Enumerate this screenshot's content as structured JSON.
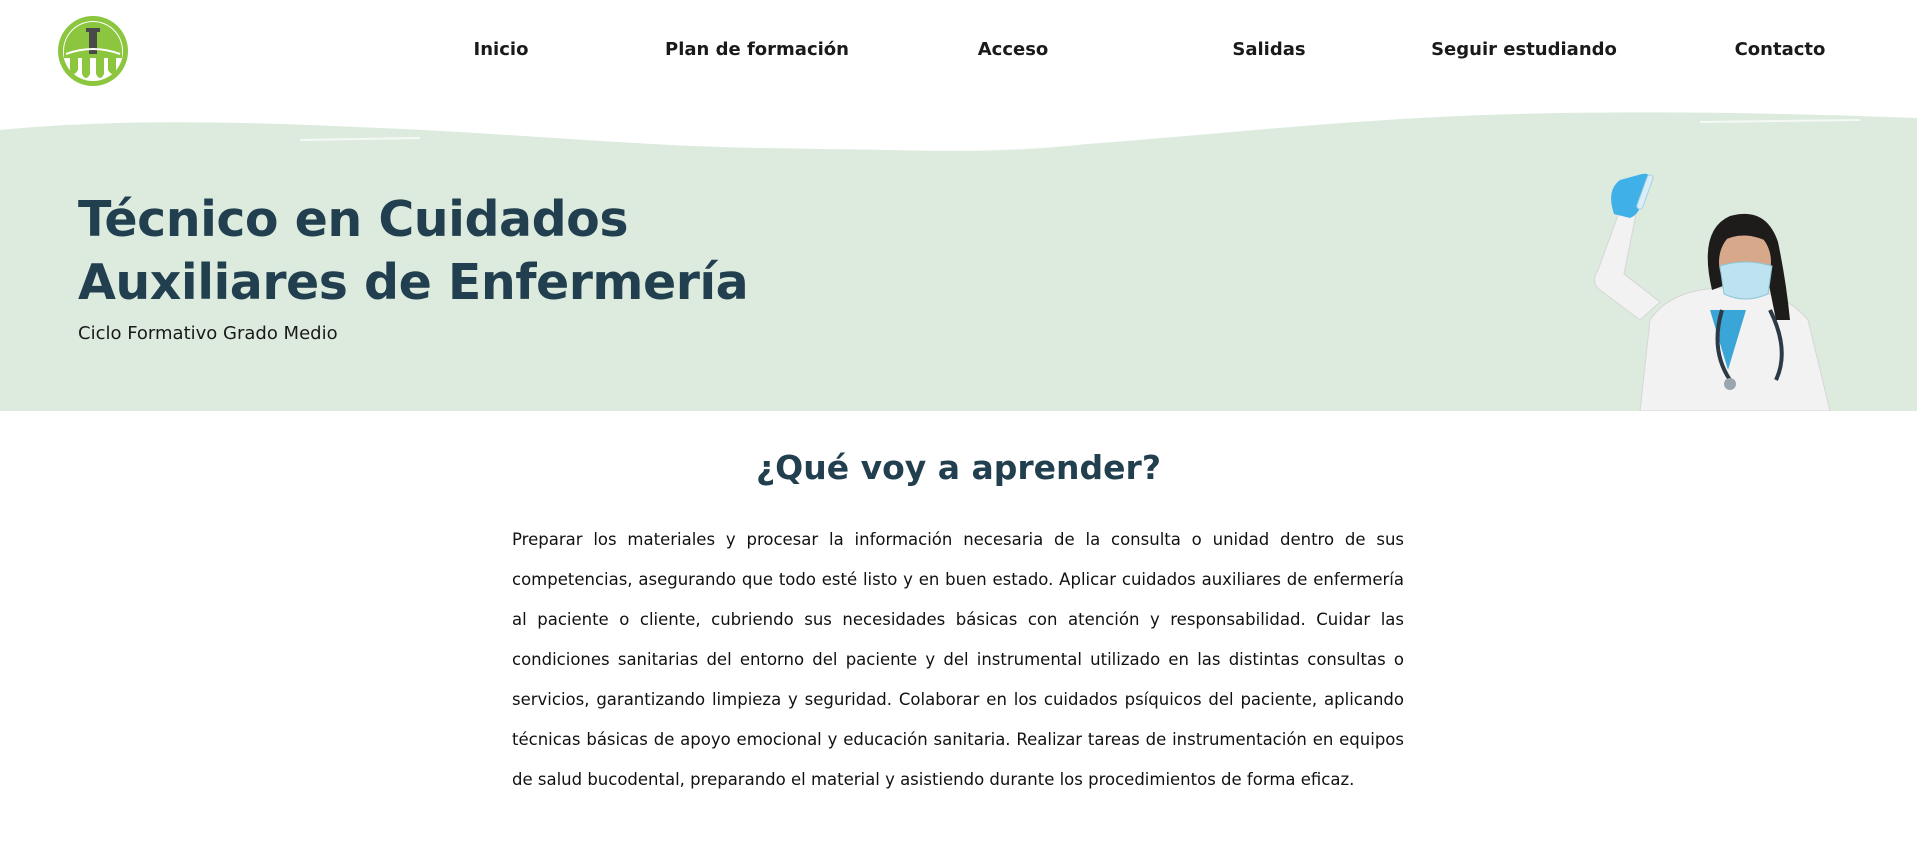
{
  "header": {
    "logo_icon": "green-arch-crest-logo",
    "nav": [
      {
        "label": "Inicio"
      },
      {
        "label": "Plan de formación"
      },
      {
        "label": "Acceso"
      },
      {
        "label": "Salidas"
      },
      {
        "label": "Seguir estudiando"
      },
      {
        "label": "Contacto"
      }
    ]
  },
  "hero": {
    "title": "Técnico en Cuidados Auxiliares de Enfermería",
    "subtitle": "Ciclo Formativo Grado Medio",
    "image": "nurse-holding-test-tube-photo"
  },
  "main": {
    "heading": "¿Qué voy a aprender?",
    "body": "Preparar los materiales y procesar la información necesaria de la consulta o unidad dentro de sus competencias, asegurando que todo esté listo y en buen estado. Aplicar cuidados auxiliares de enfermería al paciente o cliente, cubriendo sus necesidades básicas con atención y responsabilidad. Cuidar las condiciones sanitarias del entorno del paciente y del instrumental utilizado en las distintas consultas o servicios, garantizando limpieza y seguridad. Colaborar en los cuidados psíquicos del paciente, aplicando técnicas básicas de apoyo emocional y educación sanitaria. Realizar tareas de instrumentación en equipos de salud bucodental, preparando el material y asistiendo durante los procedimientos de forma eficaz."
  },
  "colors": {
    "brand_green": "#8cc63f",
    "hero_bg": "#dcebde",
    "heading_dark": "#213f4e",
    "text": "#1a1a1a"
  }
}
